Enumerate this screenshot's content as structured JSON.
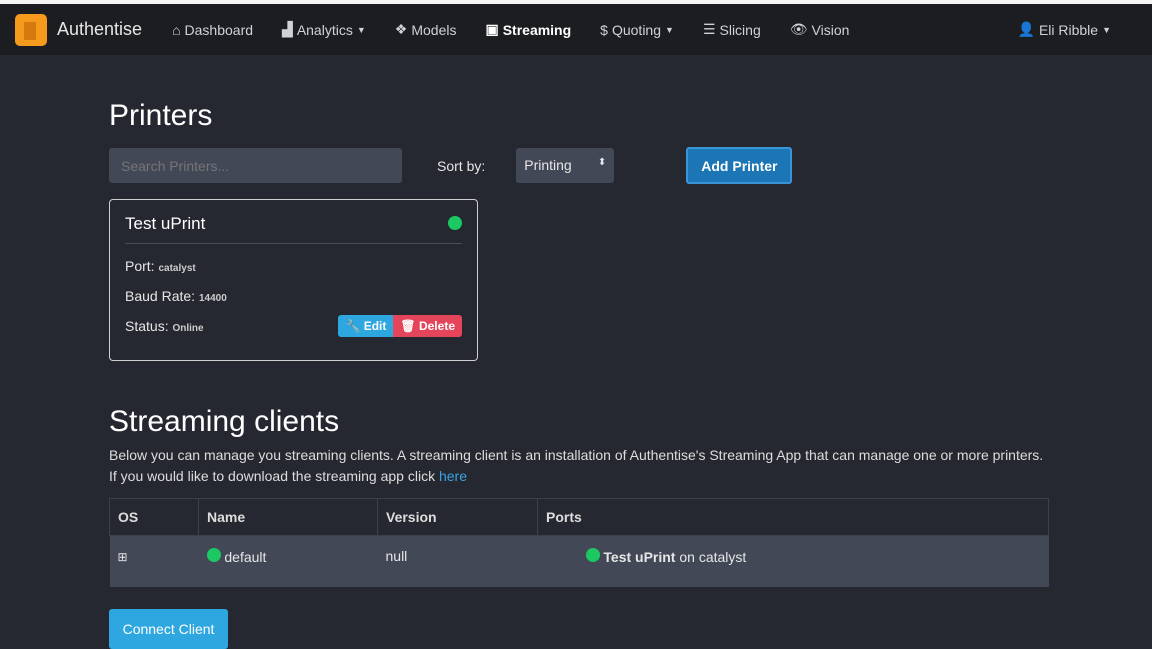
{
  "nav": {
    "brand": "Authentise",
    "links": [
      {
        "label": "Dashboard",
        "icon": "home-icon"
      },
      {
        "label": "Analytics",
        "icon": "area-chart-icon",
        "dropdown": true
      },
      {
        "label": "Models",
        "icon": "cubes-icon"
      },
      {
        "label": "Streaming",
        "icon": "calendar-icon",
        "active": true
      },
      {
        "label": "Quoting",
        "icon": "dollar-icon",
        "dropdown": true
      },
      {
        "label": "Slicing",
        "icon": "list-icon"
      },
      {
        "label": "Vision",
        "icon": "eye-icon"
      }
    ],
    "user": "Eli Ribble"
  },
  "printers": {
    "title": "Printers",
    "search_placeholder": "Search Printers...",
    "sort_label": "Sort by:",
    "sort_value": "Printing",
    "add_label": "Add Printer",
    "cards": [
      {
        "name": "Test uPrint",
        "status_color": "#1bc862",
        "port_label": "Port:",
        "port": "catalyst",
        "baud_label": "Baud Rate:",
        "baud": "14400",
        "status_label": "Status:",
        "status": "Online",
        "edit": "Edit",
        "delete": "Delete"
      }
    ]
  },
  "clients": {
    "title": "Streaming clients",
    "desc": "Below you can manage you streaming clients. A streaming client is an installation of Authentise's Streaming App that can manage one or more printers. If you would like to download the streaming app click ",
    "link": "here",
    "columns": [
      "OS",
      "Name",
      "Version",
      "Ports"
    ],
    "rows": [
      {
        "os": "windows-icon",
        "name": "default",
        "version": "null",
        "port_printer": "Test uPrint",
        "port_on": " on catalyst"
      }
    ],
    "connect": "Connect Client"
  },
  "colors": {
    "accent": "#2ea6df",
    "danger": "#e4455a",
    "online": "#1bc862"
  }
}
